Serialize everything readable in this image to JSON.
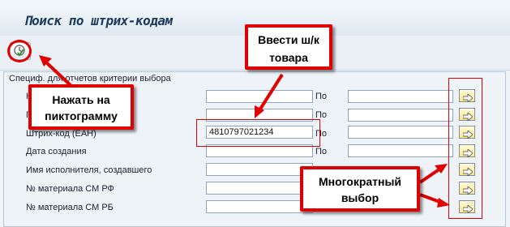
{
  "title": "Поиск по штрих-кодам",
  "toolbar": {
    "execute_icon": "execute-icon"
  },
  "group": {
    "title": "Специф. для отчетов критерии выбора",
    "range_separator": "По"
  },
  "rows": [
    {
      "label": "Н",
      "from": "",
      "to": ""
    },
    {
      "label": "Г",
      "from": "",
      "to": ""
    },
    {
      "label": "Штрих-код (ЕАН)",
      "from": "4810797021234",
      "to": ""
    },
    {
      "label": "Дата создания",
      "from": "",
      "to": ""
    },
    {
      "label": "Имя исполнителя, создавшего",
      "from": "",
      "to": ""
    },
    {
      "label": "№ материала СМ РФ",
      "from": "",
      "to": ""
    },
    {
      "label": "№ материала СМ РБ",
      "from": "",
      "to": ""
    }
  ],
  "callouts": {
    "enter_barcode": "Ввести ш/к товара",
    "press_icon": "Нажать на пиктограмму",
    "multiple_selection": "Многократный выбор"
  },
  "colors": {
    "highlight": "#e00000",
    "multi_select_button": "#ffe680"
  }
}
